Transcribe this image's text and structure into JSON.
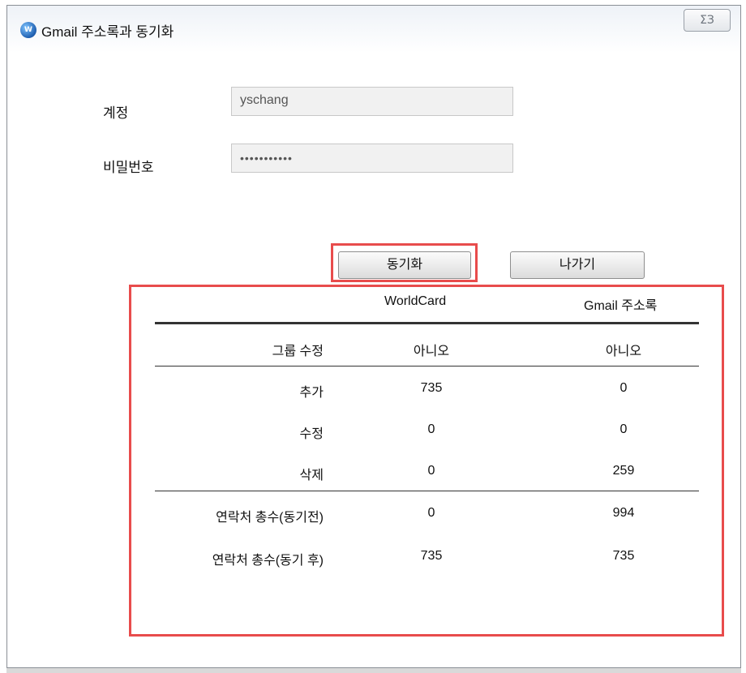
{
  "window": {
    "title": "Gmail 주소록과 동기화",
    "close_glyph": "ΣЗ"
  },
  "form": {
    "account_label": "계정",
    "account_value": "yschang",
    "password_label": "비밀번호",
    "password_value": "•••••••••••"
  },
  "buttons": {
    "sync": "동기화",
    "exit": "나가기"
  },
  "results": {
    "col_worldcard": "WorldCard",
    "col_gmail": "Gmail 주소록",
    "rows": [
      {
        "label": "그룹 수정",
        "worldcard": "아니오",
        "gmail": "아니오"
      },
      {
        "label": "추가",
        "worldcard": "735",
        "gmail": "0"
      },
      {
        "label": "수정",
        "worldcard": "0",
        "gmail": "0"
      },
      {
        "label": "삭제",
        "worldcard": "0",
        "gmail": "259"
      },
      {
        "label": "연락처 총수(동기전)",
        "worldcard": "0",
        "gmail": "994"
      },
      {
        "label": "연락처 총수(동기 후)",
        "worldcard": "735",
        "gmail": "735"
      }
    ]
  },
  "colors": {
    "highlight": "#e84c4c"
  }
}
